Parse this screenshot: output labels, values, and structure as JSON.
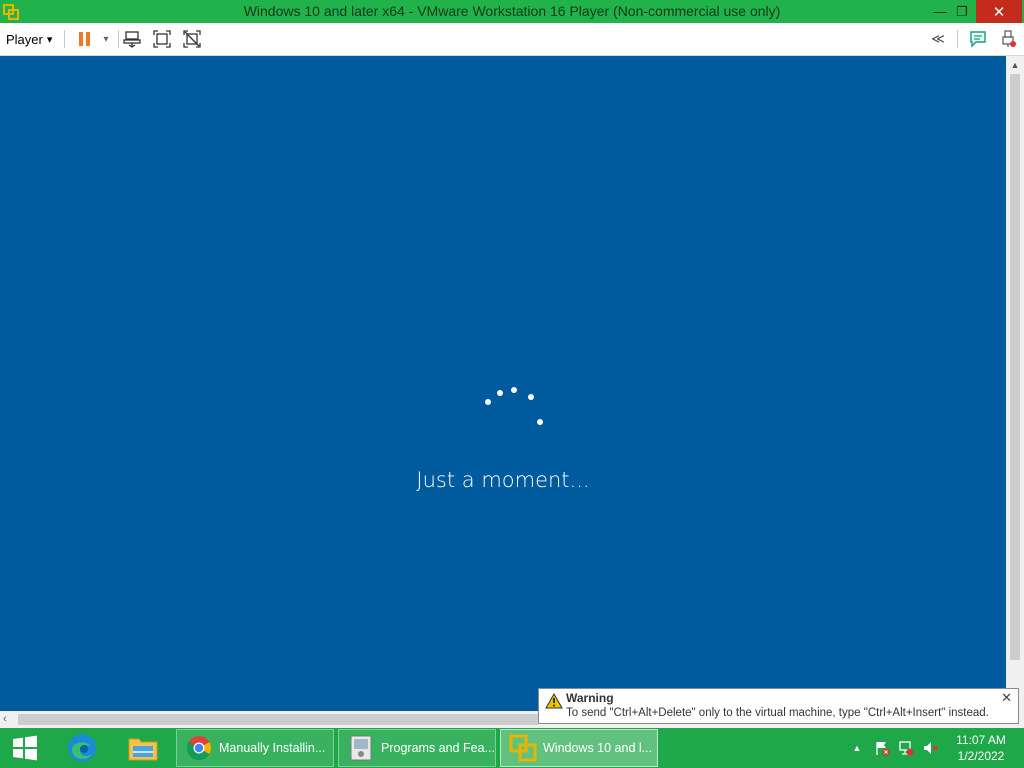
{
  "window": {
    "title": "Windows 10 and later x64 - VMware Workstation 16 Player (Non-commercial use only)",
    "minimize_glyph": "—",
    "restore_glyph": "❐",
    "close_glyph": "✕"
  },
  "toolbar": {
    "player_label": "Player",
    "dropdown_glyph": "▾",
    "collapse_glyph": "≪"
  },
  "vm": {
    "status_text": "Just a moment...",
    "background_color": "#005a9e"
  },
  "notification": {
    "title": "Warning",
    "message": "To send \"Ctrl+Alt+Delete\" only to the virtual machine, type \"Ctrl+Alt+Insert\" instead.",
    "close_glyph": "✕"
  },
  "taskbar": {
    "buttons": [
      {
        "label": "Manually Installin...",
        "icon": "chrome-icon"
      },
      {
        "label": "Programs and Fea...",
        "icon": "programs-features-icon"
      },
      {
        "label": "Windows 10 and l...",
        "icon": "vmware-icon"
      }
    ],
    "tray_arrow": "▲",
    "time": "11:07 AM",
    "date": "1/2/2022"
  },
  "colors": {
    "titlebar": "#22b24c",
    "taskbar": "#1ea84a",
    "accent_orange": "#f07a22"
  }
}
